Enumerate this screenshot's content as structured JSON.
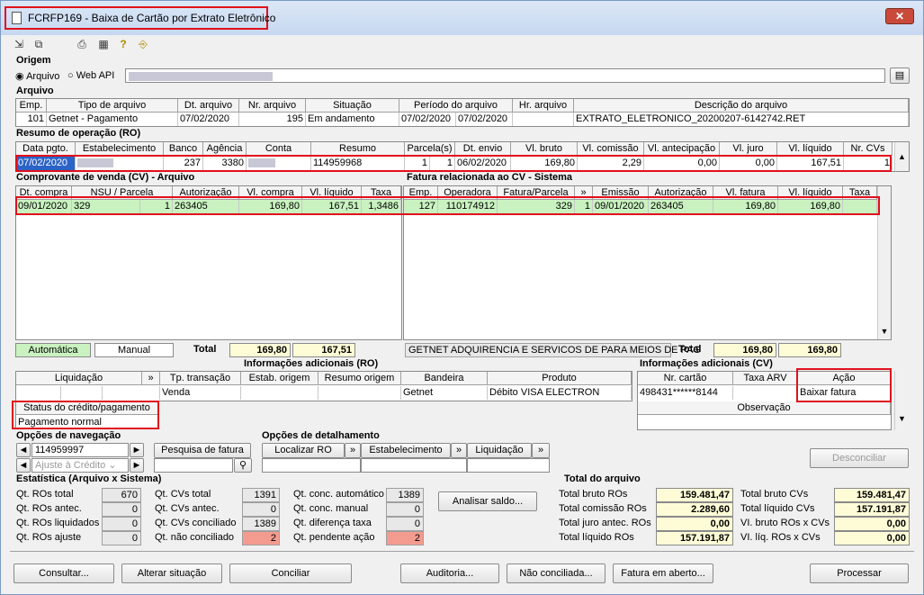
{
  "window": {
    "title": "FCRFP169 - Baixa de Cartão por Extrato Eletrônico",
    "close": "✕"
  },
  "toolbar": {
    "icons": [
      "new-icon",
      "copy-icon",
      "print-icon",
      "grid-icon",
      "help-icon",
      "exit-icon"
    ]
  },
  "origem": {
    "label": "Origem",
    "opt1": "Arquivo",
    "opt2": "Web API",
    "path": ""
  },
  "arquivo": {
    "label": "Arquivo",
    "headers": [
      "Emp.",
      "Tipo de arquivo",
      "Dt. arquivo",
      "Nr. arquivo",
      "Situação",
      "Período do arquivo",
      "Hr. arquivo",
      "Descrição do arquivo"
    ],
    "row": [
      "101",
      "Getnet - Pagamento",
      "07/02/2020",
      "195",
      "Em andamento",
      "07/02/2020",
      "07/02/2020",
      "",
      "EXTRATO_ELETRONICO_20200207-6142742.RET"
    ]
  },
  "ro": {
    "label": "Resumo de operação (RO)",
    "headers": [
      "Data pgto.",
      "Estabelecimento",
      "Banco",
      "Agência",
      "Conta",
      "Resumo",
      "Parcela(s)",
      "Dt. envio",
      "Vl. bruto",
      "Vl. comissão",
      "Vl. antecipação",
      "Vl. juro",
      "Vl. líquido",
      "Nr. CVs"
    ],
    "row": [
      "07/02/2020",
      "",
      "237",
      "3380",
      "",
      "114959968",
      "1",
      "1",
      "06/02/2020",
      "169,80",
      "2,29",
      "0,00",
      "0,00",
      "167,51",
      "1"
    ]
  },
  "cv": {
    "label": "Comprovante de venda (CV) - Arquivo",
    "headers": [
      "Dt. compra",
      "NSU / Parcela",
      "Autorização",
      "Vl. compra",
      "Vl. líquido",
      "Taxa"
    ],
    "row": [
      "09/01/2020",
      "329",
      "1",
      "263405",
      "169,80",
      "167,51",
      "1,3486"
    ],
    "legend_auto": "Automática",
    "legend_manual": "Manual",
    "total_label": "Total",
    "total_compra": "169,80",
    "total_liquido": "167,51"
  },
  "fatura": {
    "label": "Fatura relacionada ao CV - Sistema",
    "headers": [
      "Emp.",
      "Operadora",
      "Fatura/Parcela",
      "»",
      "Emissão",
      "Autorização",
      "Vl. fatura",
      "Vl. líquido",
      "Taxa"
    ],
    "row": [
      "127",
      "110174912",
      "329",
      "1",
      "09/01/2020",
      "263405",
      "169,80",
      "169,80",
      ""
    ],
    "operadora_nome": "GETNET ADQUIRENCIA E SERVICOS DE PARA MEIOS DE PAG",
    "total_label": "Total",
    "total_fatura": "169,80",
    "total_liquido": "169,80"
  },
  "info_ro": {
    "label": "Informações adicionais (RO)",
    "headers": [
      "Liquidação",
      "»",
      "Tp. transação",
      "Estab. origem",
      "Resumo origem",
      "Bandeira",
      "Produto"
    ],
    "row": [
      "Venda",
      "Getnet",
      "Débito VISA ELECTRON"
    ],
    "status_label": "Status do crédito/pagamento",
    "status_value": "Pagamento normal"
  },
  "info_cv": {
    "label": "Informações adicionais (CV)",
    "headers": [
      "Nr. cartão",
      "Taxa ARV",
      "Ação"
    ],
    "row": [
      "498431******8144",
      "",
      "Baixar fatura"
    ],
    "obs_label": "Observação"
  },
  "nav": {
    "label": "Opções de navegação",
    "value": "114959997",
    "ajuste": "Ajuste à Crédito",
    "pesquisa": "Pesquisa de fatura"
  },
  "detalhe": {
    "label": "Opções de detalhamento",
    "btns": [
      "Localizar RO",
      "»",
      "Estabelecimento",
      "»",
      "Liquidação",
      "»"
    ]
  },
  "desconciliar": "Desconciliar",
  "estat": {
    "label": "Estatística (Arquivo x Sistema)",
    "c1": [
      [
        "Qt. ROs total",
        "670"
      ],
      [
        "Qt. ROs antec.",
        "0"
      ],
      [
        "Qt. ROs liquidados",
        "0"
      ],
      [
        "Qt. ROs ajuste",
        "0"
      ]
    ],
    "c2": [
      [
        "Qt. CVs total",
        "1391"
      ],
      [
        "Qt. CVs antec.",
        "0"
      ],
      [
        "Qt. CVs conciliado",
        "1389"
      ],
      [
        "Qt. não conciliado",
        "2"
      ]
    ],
    "c3": [
      [
        "Qt. conc. automático",
        "1389"
      ],
      [
        "Qt. conc. manual",
        "0"
      ],
      [
        "Qt. diferença taxa",
        "0"
      ],
      [
        "Qt. pendente ação",
        "2"
      ]
    ],
    "analisar": "Analisar saldo..."
  },
  "total": {
    "label": "Total do arquivo",
    "c1": [
      [
        "Total bruto ROs",
        "159.481,47"
      ],
      [
        "Total comissão ROs",
        "2.289,60"
      ],
      [
        "Total juro antec. ROs",
        "0,00"
      ],
      [
        "Total líquido ROs",
        "157.191,87"
      ]
    ],
    "c2": [
      [
        "Total bruto CVs",
        "159.481,47"
      ],
      [
        "Total líquido CVs",
        "157.191,87"
      ],
      [
        "VI. bruto ROs x CVs",
        "0,00"
      ],
      [
        "VI. líq. ROs x CVs",
        "0,00"
      ]
    ]
  },
  "footer": [
    "Consultar...",
    "Alterar situação",
    "Conciliar",
    "Auditoria...",
    "Não conciliada...",
    "Fatura em aberto...",
    "Processar"
  ],
  "colors": {
    "red": "#e0101c",
    "green": "#c9f2c0",
    "yellow": "#fefcd7",
    "pink": "#f49b8f"
  }
}
